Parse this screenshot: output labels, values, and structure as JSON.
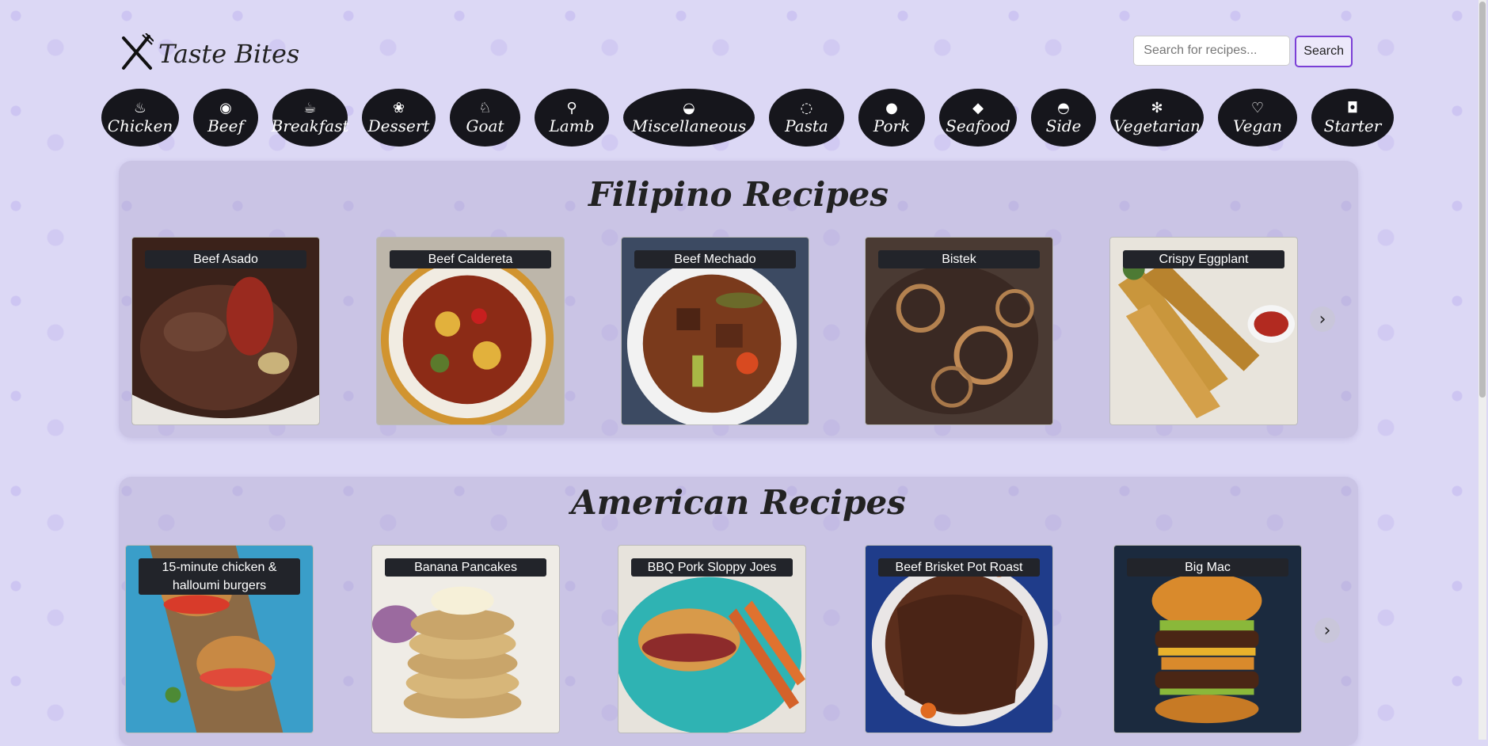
{
  "header": {
    "brand": "Taste Bites",
    "search_placeholder": "Search for recipes...",
    "search_label": "Search"
  },
  "categories": [
    {
      "label": "Chicken",
      "icon": "chicken-icon"
    },
    {
      "label": "Beef",
      "icon": "steak-icon"
    },
    {
      "label": "Breakfast",
      "icon": "coffee-icon"
    },
    {
      "label": "Dessert",
      "icon": "cupcake-icon"
    },
    {
      "label": "Goat",
      "icon": "goat-icon"
    },
    {
      "label": "Lamb",
      "icon": "drumstick-icon"
    },
    {
      "label": "Miscellaneous",
      "icon": "bowl-icon"
    },
    {
      "label": "Pasta",
      "icon": "pasta-icon"
    },
    {
      "label": "Pork",
      "icon": "pig-icon"
    },
    {
      "label": "Seafood",
      "icon": "fish-icon"
    },
    {
      "label": "Side",
      "icon": "rice-bowl-icon"
    },
    {
      "label": "Vegetarian",
      "icon": "herb-icon"
    },
    {
      "label": "Vegan",
      "icon": "leaf-icon"
    },
    {
      "label": "Starter",
      "icon": "burger-icon"
    }
  ],
  "sections": [
    {
      "title": "Filipino Recipes",
      "recipes": [
        "Beef Asado",
        "Beef Caldereta",
        "Beef Mechado",
        "Bistek",
        "Crispy Eggplant"
      ]
    },
    {
      "title": "American Recipes",
      "recipes": [
        "15-minute chicken & halloumi burgers",
        "Banana Pancakes",
        "BBQ Pork Sloppy Joes",
        "Beef Brisket Pot Roast",
        "Big Mac"
      ]
    }
  ]
}
